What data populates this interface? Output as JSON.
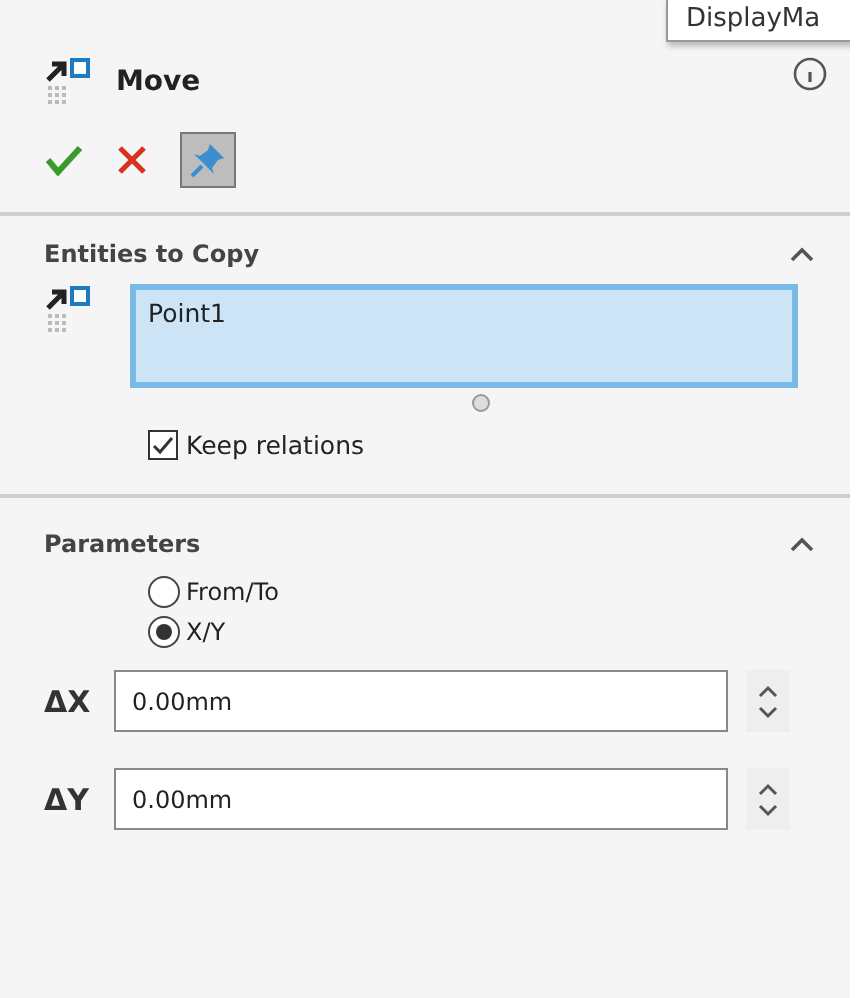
{
  "header": {
    "title": "Move"
  },
  "tooltip": {
    "text": "DisplayMa"
  },
  "actions": [
    {
      "kind": "ok"
    },
    {
      "kind": "cancel"
    },
    {
      "kind": "pin",
      "selected": true
    }
  ],
  "entities": {
    "title": "Entities to Copy",
    "expanded": true,
    "selection": "Point1",
    "keep_relations": {
      "label": "Keep relations",
      "checked": true
    }
  },
  "parameters": {
    "title": "Parameters",
    "expanded": true,
    "options": [
      {
        "label": "From/To",
        "selected": false
      },
      {
        "label": "X/Y",
        "selected": true
      }
    ],
    "fields": [
      {
        "label": "ΔX",
        "value": "0.00mm"
      },
      {
        "label": "ΔY",
        "value": "0.00mm"
      }
    ]
  }
}
